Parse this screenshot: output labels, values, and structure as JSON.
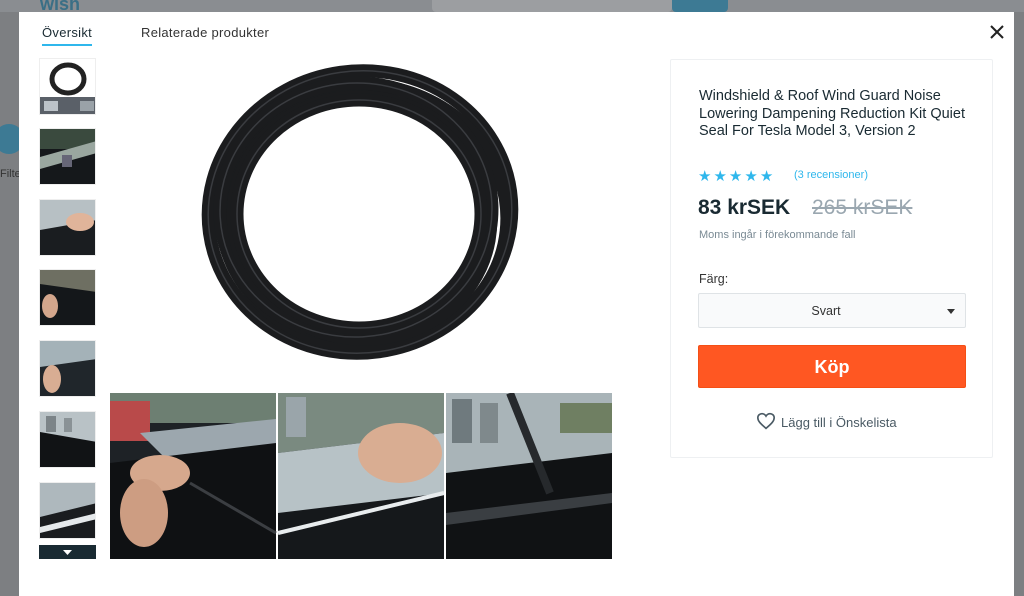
{
  "tabs": [
    {
      "label": "Översikt",
      "active": true
    },
    {
      "label": "Relaterade produkter",
      "active": false
    }
  ],
  "background": {
    "filter_label": "Filte"
  },
  "product": {
    "title": "Windshield & Roof Wind Guard Noise Lowering Dampening Reduction Kit Quiet Seal For Tesla Model 3, Version 2",
    "rating_stars": 5,
    "reviews_label": "(3 recensioner)",
    "price": "83 krSEK",
    "old_price": "265 krSEK",
    "vat_note": "Moms ingår i förekommande fall",
    "color_label": "Färg:",
    "color_selected": "Svart",
    "buy_label": "Köp",
    "wishlist_label": "Lägg till i Önskelista"
  },
  "icons": {
    "close": "close-icon",
    "star": "star-icon",
    "heart": "heart-icon",
    "caret": "caret-down-icon"
  },
  "colors": {
    "accent": "#2fb7ec",
    "buy": "#ff5722",
    "text": "#192a32"
  }
}
